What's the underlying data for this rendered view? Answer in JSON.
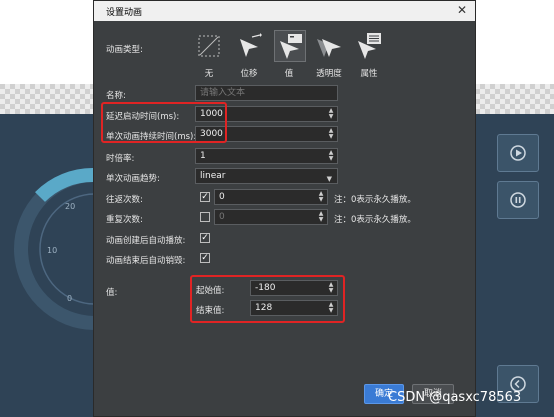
{
  "dialog": {
    "title": "设置动画",
    "anim_type_label": "动画类型:",
    "anim_types": [
      {
        "label": "无",
        "icon": "none-icon"
      },
      {
        "label": "位移",
        "icon": "move-icon"
      },
      {
        "label": "值",
        "icon": "value-icon",
        "selected": true
      },
      {
        "label": "透明度",
        "icon": "opacity-icon"
      },
      {
        "label": "属性",
        "icon": "property-icon"
      }
    ],
    "name_label": "名称:",
    "name_placeholder": "请输入文本",
    "delay_label": "延迟启动时间(ms):",
    "delay_value": "1000",
    "duration_label": "单次动画持续时间(ms):",
    "duration_value": "3000",
    "speed_label": "时倍率:",
    "speed_value": "1",
    "easing_label": "单次动画趋势:",
    "easing_value": "linear",
    "pingpong_label": "往返次数:",
    "pingpong_value": "0",
    "pingpong_note": "注：0表示永久播放。",
    "repeat_label": "重复次数:",
    "repeat_value": "0",
    "repeat_note": "注：0表示永久播放。",
    "autoplay_label": "动画创建后自动播放:",
    "autodestroy_label": "动画结束后自动销毁:",
    "value_label": "值:",
    "start_label": "起始值:",
    "start_value": "-180",
    "end_label": "结束值:",
    "end_value": "128",
    "ok_label": "确定",
    "cancel_label": "取消"
  },
  "background": {
    "gauge_ticks": [
      "20",
      "10",
      "0"
    ]
  },
  "watermark": "CSDN @qasxc78563",
  "colors": {
    "highlight": "#e02424",
    "primary": "#3a7bd5",
    "dialog_bg": "#3c3f41",
    "gauge_arc": "#5aa9c8"
  }
}
